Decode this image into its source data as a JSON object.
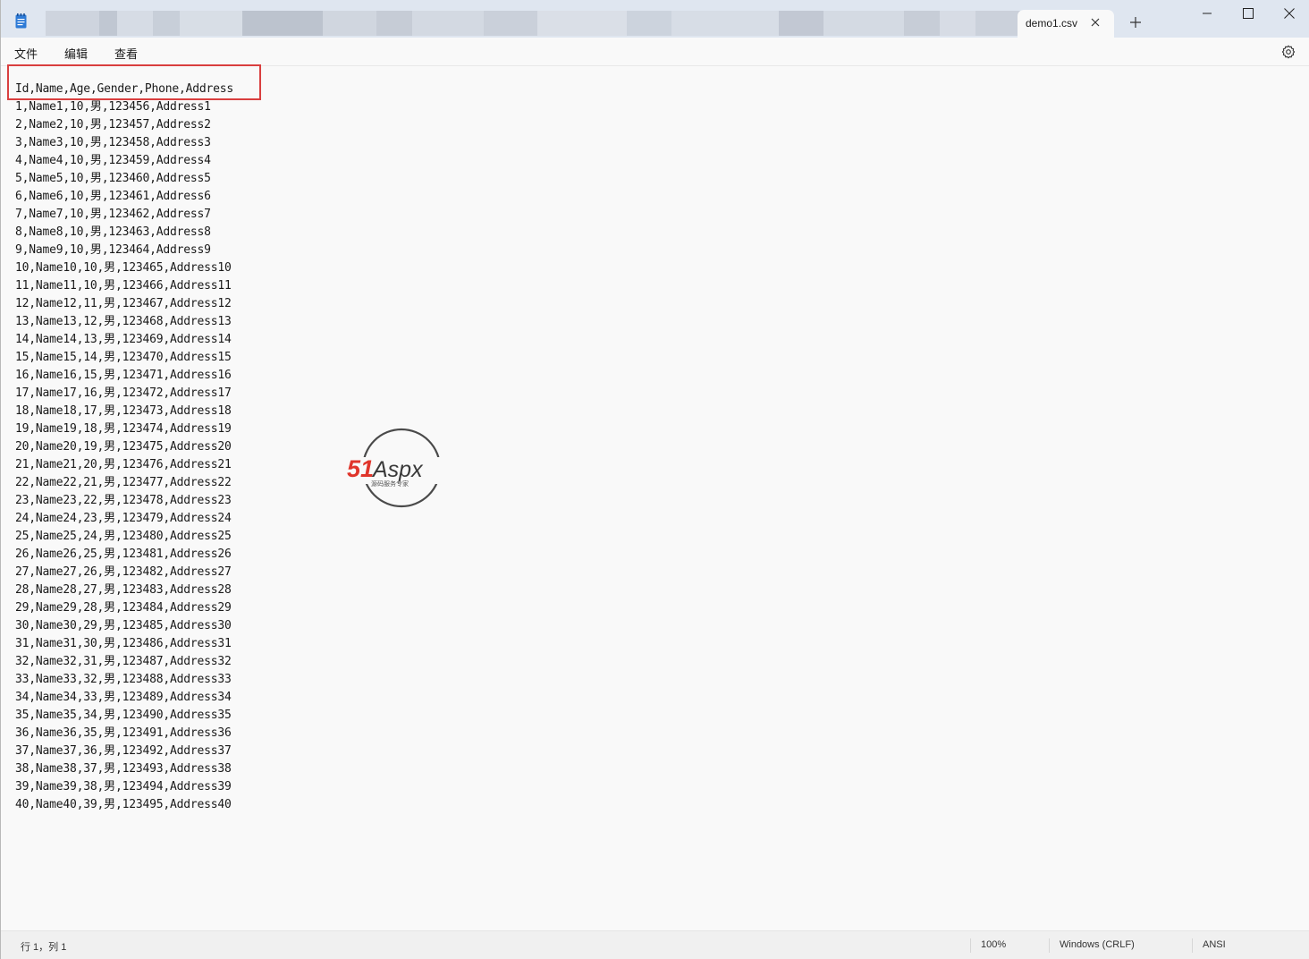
{
  "window": {
    "tab_title": "demo1.csv"
  },
  "menu": {
    "file": "文件",
    "edit": "编辑",
    "view": "查看"
  },
  "editor": {
    "lines": [
      "Id,Name,Age,Gender,Phone,Address",
      "1,Name1,10,男,123456,Address1",
      "2,Name2,10,男,123457,Address2",
      "3,Name3,10,男,123458,Address3",
      "4,Name4,10,男,123459,Address4",
      "5,Name5,10,男,123460,Address5",
      "6,Name6,10,男,123461,Address6",
      "7,Name7,10,男,123462,Address7",
      "8,Name8,10,男,123463,Address8",
      "9,Name9,10,男,123464,Address9",
      "10,Name10,10,男,123465,Address10",
      "11,Name11,10,男,123466,Address11",
      "12,Name12,11,男,123467,Address12",
      "13,Name13,12,男,123468,Address13",
      "14,Name14,13,男,123469,Address14",
      "15,Name15,14,男,123470,Address15",
      "16,Name16,15,男,123471,Address16",
      "17,Name17,16,男,123472,Address17",
      "18,Name18,17,男,123473,Address18",
      "19,Name19,18,男,123474,Address19",
      "20,Name20,19,男,123475,Address20",
      "21,Name21,20,男,123476,Address21",
      "22,Name22,21,男,123477,Address22",
      "23,Name23,22,男,123478,Address23",
      "24,Name24,23,男,123479,Address24",
      "25,Name25,24,男,123480,Address25",
      "26,Name26,25,男,123481,Address26",
      "27,Name27,26,男,123482,Address27",
      "28,Name28,27,男,123483,Address28",
      "29,Name29,28,男,123484,Address29",
      "30,Name30,29,男,123485,Address30",
      "31,Name31,30,男,123486,Address31",
      "32,Name32,31,男,123487,Address32",
      "33,Name33,32,男,123488,Address33",
      "34,Name34,33,男,123489,Address34",
      "35,Name35,34,男,123490,Address35",
      "36,Name36,35,男,123491,Address36",
      "37,Name37,36,男,123492,Address37",
      "38,Name38,37,男,123493,Address38",
      "39,Name39,38,男,123494,Address39",
      "40,Name40,39,男,123495,Address40"
    ]
  },
  "watermark": {
    "brand_num": "51",
    "brand_name": "Aspx",
    "tagline": "源码服务专家"
  },
  "statusbar": {
    "position": "行 1，列 1",
    "zoom": "100%",
    "line_ending": "Windows (CRLF)",
    "encoding": "ANSI"
  },
  "colors": {
    "highlight_border": "#d93f3f",
    "titlebar_bg": "#dfe6f0",
    "editor_bg": "#f9f9f9",
    "app_icon": "#1a6fd1",
    "watermark_red": "#e0352b",
    "watermark_green": "#2e9d3c"
  }
}
